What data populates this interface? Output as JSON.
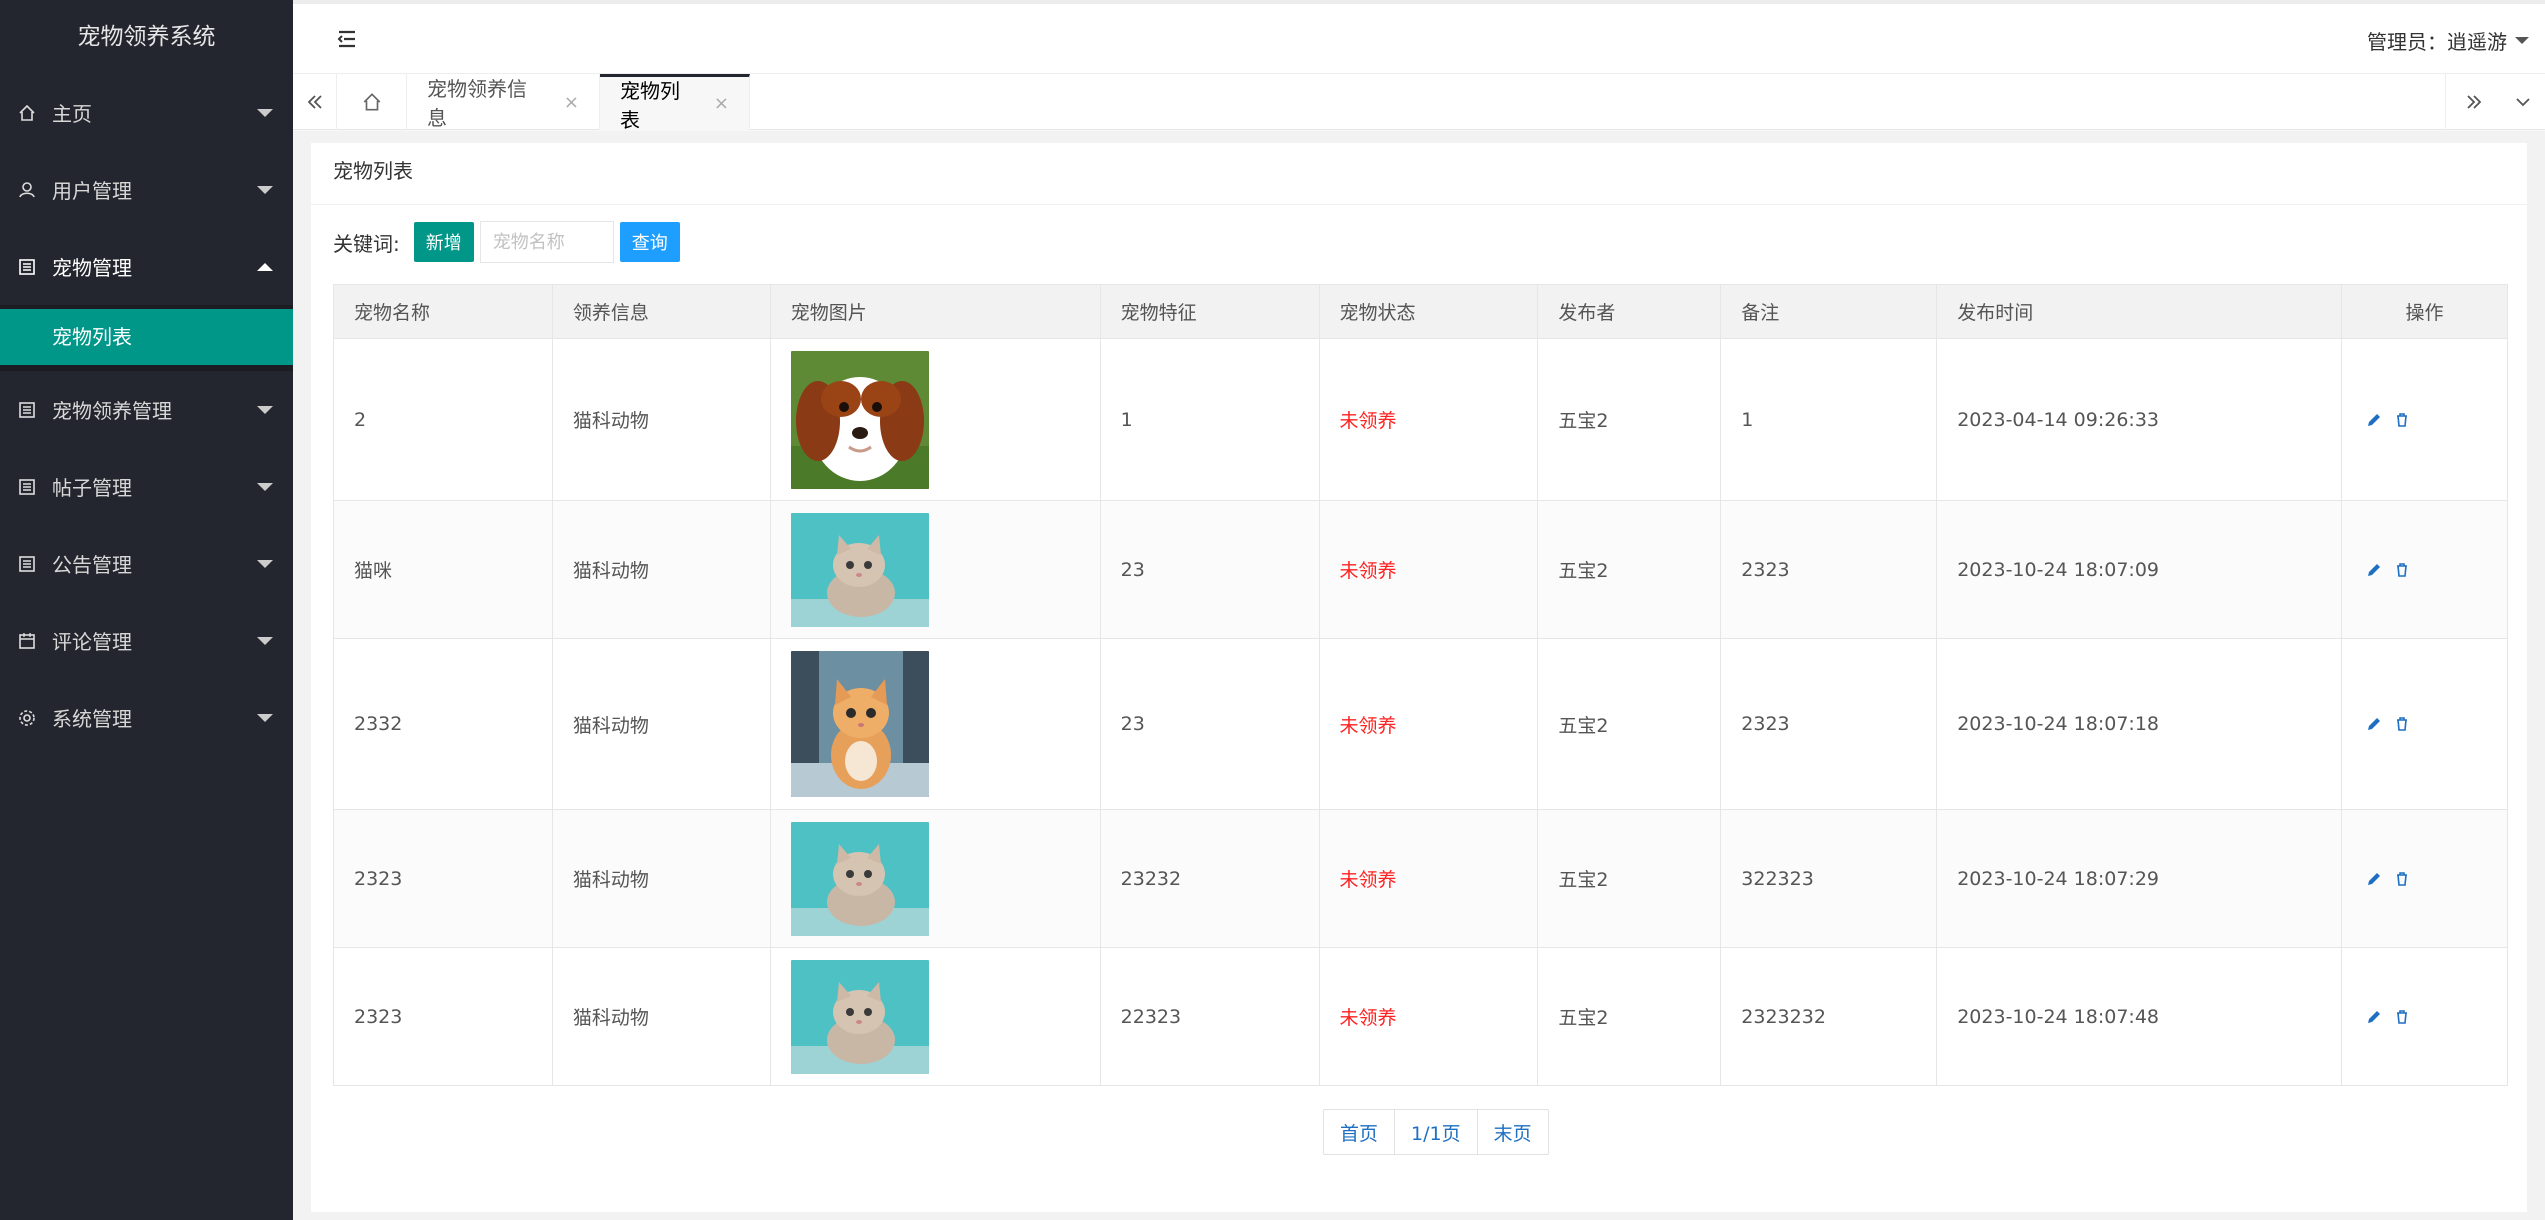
{
  "app": {
    "title": "宠物领养系统"
  },
  "sidebar": {
    "items": [
      {
        "label": "主页"
      },
      {
        "label": "用户管理"
      },
      {
        "label": "宠物管理",
        "sub": [
          {
            "label": "宠物列表"
          }
        ]
      },
      {
        "label": "宠物领养管理"
      },
      {
        "label": "帖子管理"
      },
      {
        "label": "公告管理"
      },
      {
        "label": "评论管理"
      },
      {
        "label": "系统管理"
      }
    ]
  },
  "header": {
    "user": "管理员：逍遥游"
  },
  "tabs": [
    {
      "label": "宠物领养信息",
      "close": "×"
    },
    {
      "label": "宠物列表",
      "close": "×"
    }
  ],
  "page": {
    "title": "宠物列表",
    "keyword_label": "关键词:",
    "add_button": "新增",
    "search_placeholder": "宠物名称",
    "search_button": "查询"
  },
  "table": {
    "columns": [
      "宠物名称",
      "领养信息",
      "宠物图片",
      "宠物特征",
      "宠物状态",
      "发布者",
      "备注",
      "发布时间",
      "操作"
    ],
    "rows": [
      {
        "name": "2",
        "info": "猫科动物",
        "image": "puppy-photo",
        "feature": "1",
        "status": "未领养",
        "publisher": "五宝2",
        "note": "1",
        "time": "2023-04-14 09:26:33"
      },
      {
        "name": "猫咪",
        "info": "猫科动物",
        "image": "kitten-photo",
        "feature": "23",
        "status": "未领养",
        "publisher": "五宝2",
        "note": "2323",
        "time": "2023-10-24 18:07:09"
      },
      {
        "name": "2332",
        "info": "猫科动物",
        "image": "orange-kitten-photo",
        "feature": "23",
        "status": "未领养",
        "publisher": "五宝2",
        "note": "2323",
        "time": "2023-10-24 18:07:18"
      },
      {
        "name": "2323",
        "info": "猫科动物",
        "image": "kitten-photo",
        "feature": "23232",
        "status": "未领养",
        "publisher": "五宝2",
        "note": "322323",
        "time": "2023-10-24 18:07:29"
      },
      {
        "name": "2323",
        "info": "猫科动物",
        "image": "kitten-photo",
        "feature": "22323",
        "status": "未领养",
        "publisher": "五宝2",
        "note": "2323232",
        "time": "2023-10-24 18:07:48"
      }
    ]
  },
  "pagination": {
    "first": "首页",
    "current": "1/1页",
    "last": "末页"
  },
  "colors": {
    "sidebar_bg": "#23262e",
    "accent_green": "#009688",
    "accent_blue": "#1e9fff",
    "status_red": "#ff2222"
  }
}
